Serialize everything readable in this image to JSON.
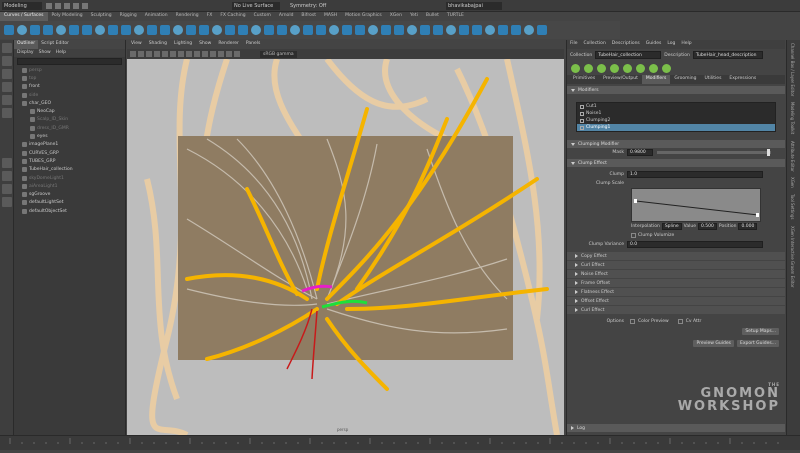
{
  "topbar": {
    "mode": "Modeling",
    "live_surface": "No Live Surface",
    "symmetry": "Symmetry: Off",
    "user": "bhavikabajpai"
  },
  "shelf_tabs": [
    "Curves / Surfaces",
    "Poly Modeling",
    "Sculpting",
    "Rigging",
    "Animation",
    "Rendering",
    "FX",
    "FX Caching",
    "Custom",
    "Arnold",
    "Bifrost",
    "MASH",
    "Motion Graphics",
    "XGen",
    "Yeti",
    "Bullet",
    "TURTLE"
  ],
  "outliner": {
    "tabs": [
      "Outliner",
      "Script Editor"
    ],
    "menu": [
      "Display",
      "Show",
      "Help"
    ],
    "items": [
      {
        "label": "persp",
        "dim": true,
        "indent": 1
      },
      {
        "label": "top",
        "dim": true,
        "indent": 1
      },
      {
        "label": "front",
        "dim": false,
        "indent": 1
      },
      {
        "label": "side",
        "dim": true,
        "indent": 1
      },
      {
        "label": "char_GEO",
        "dim": false,
        "indent": 1
      },
      {
        "label": "NeoCap",
        "dim": false,
        "indent": 2
      },
      {
        "label": "Scalp_ID_Skin",
        "dim": true,
        "indent": 2
      },
      {
        "label": "dress_ID_GMR",
        "dim": true,
        "indent": 2
      },
      {
        "label": "eyes",
        "dim": false,
        "indent": 2
      },
      {
        "label": "imagePlane1",
        "dim": false,
        "indent": 1
      },
      {
        "label": "CURVES_GRP",
        "dim": false,
        "indent": 1
      },
      {
        "label": "TUBES_GRP",
        "dim": false,
        "indent": 1
      },
      {
        "label": "TubeHair_collection",
        "dim": false,
        "indent": 1
      },
      {
        "label": "skyDomeLight1",
        "dim": true,
        "indent": 1
      },
      {
        "label": "aiAreaLight1",
        "dim": true,
        "indent": 1
      },
      {
        "label": "sgGroove",
        "dim": false,
        "indent": 1
      },
      {
        "label": "defaultLightSet",
        "dim": false,
        "indent": 1
      },
      {
        "label": "defaultObjectSet",
        "dim": false,
        "indent": 1
      }
    ]
  },
  "viewport": {
    "menu": [
      "View",
      "Shading",
      "Lighting",
      "Show",
      "Renderer",
      "Panels"
    ],
    "color_space": "sRGB gamma",
    "camera_label": "persp"
  },
  "xgen": {
    "menu": [
      "File",
      "Collection",
      "Descriptions",
      "Guides",
      "Log",
      "Help"
    ],
    "collection_label": "Collection",
    "collection": "TubeHair_collection",
    "description_label": "Description",
    "description": "TubeHair_head_description",
    "tabs": [
      "Primitives",
      "Preview/Output",
      "Modifiers",
      "Grooming",
      "Utilities",
      "Expressions"
    ],
    "active_tab": "Modifiers",
    "modifiers_header": "Modifiers",
    "modifiers": [
      {
        "label": "Cut1",
        "selected": false
      },
      {
        "label": "Noise1",
        "selected": false
      },
      {
        "label": "Clumping2",
        "selected": false
      },
      {
        "label": "Clumping1",
        "selected": true
      }
    ],
    "clumping_modifier_header": "Clumping Modifier",
    "mask_label": "Mask",
    "mask_value": "0.9800",
    "mask_fraction": 0.98,
    "clump_effect_header": "Clump Effect",
    "clump_label": "Clump",
    "clump_value": "1.0",
    "clump_scale_label": "Clump Scale",
    "interpolation_label": "Interpolation",
    "interpolation": "Spline",
    "value_label": "Value",
    "value": "0.500",
    "position_label": "Position",
    "position": "0.000",
    "clump_volumize": "Clump Volumize",
    "clump_variance_label": "Clump Variance",
    "clump_variance_value": "0.0",
    "collapsed_sections": [
      "Copy Effect",
      "Curl Effect",
      "Noise Effect",
      "Frame Offset",
      "Flatness Effect",
      "Offset Effect",
      "Curl Effect"
    ],
    "options_label": "Options",
    "color_preview": "Color Preview",
    "cv_attr": "Cv Attr",
    "setup_maps": "Setup Maps...",
    "preview_guides": "Preview Guides",
    "export_guides": "Export Guides...",
    "log_label": "Log"
  },
  "right_tabs": [
    "Channel Box / Layer Editor",
    "Modeling Toolkit",
    "Attribute Editor",
    "XGen",
    "Tool Settings",
    "XGen Interactive Groom Editor"
  ],
  "watermark": {
    "small": "THE",
    "line1": "GNOMON",
    "line2": "WORKSHOP"
  },
  "colors": {
    "accent_blue": "#5285a6",
    "hair_yellow": "#f5b400",
    "hair_light": "#f2cf94"
  }
}
